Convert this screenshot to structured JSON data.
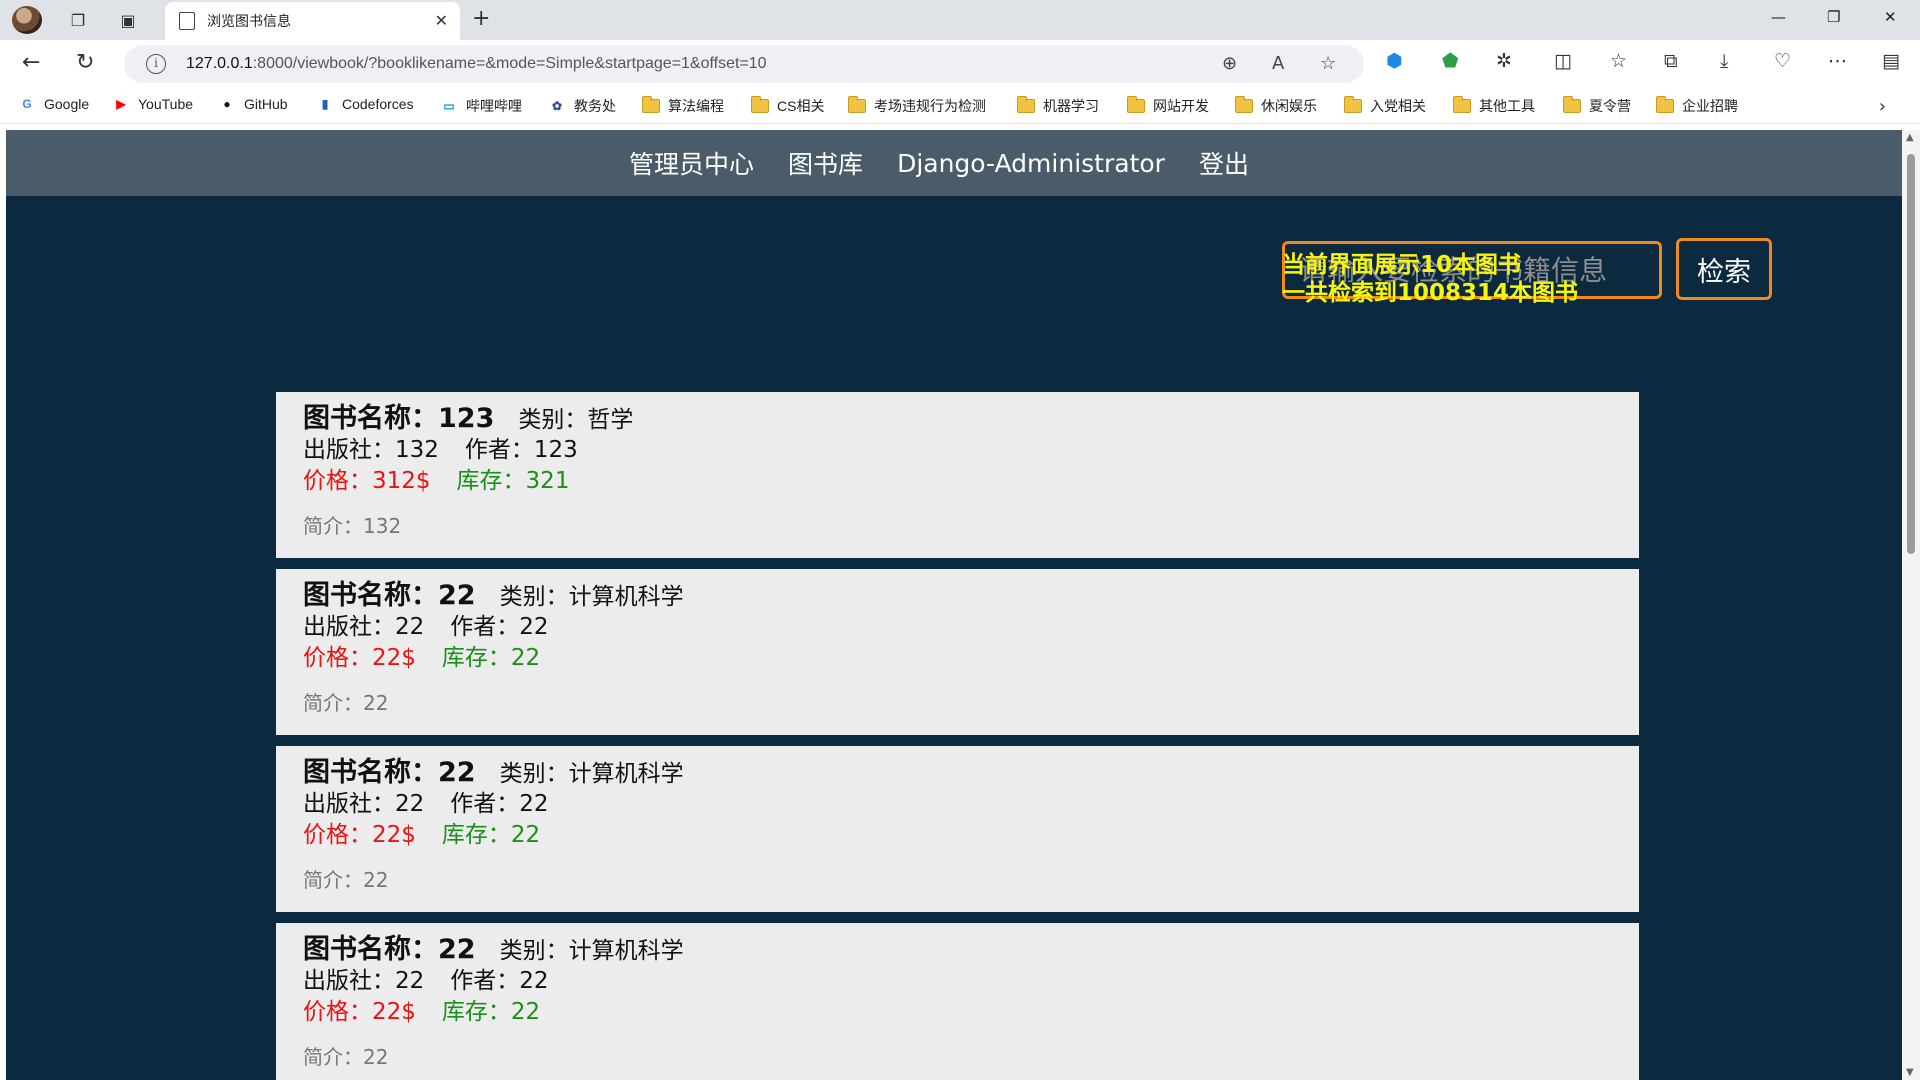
{
  "browser": {
    "tab_title": "浏览图书信息",
    "url_host": "127.0.0.1",
    "url_rest": ":8000/viewbook/?booklikename=&mode=Simple&startpage=1&offset=10",
    "bookmarks": [
      {
        "label": "Google",
        "icon": "google-icon"
      },
      {
        "label": "YouTube",
        "icon": "youtube-icon"
      },
      {
        "label": "GitHub",
        "icon": "github-icon"
      },
      {
        "label": "Codeforces",
        "icon": "codeforces-icon"
      },
      {
        "label": "哔哩哔哩",
        "icon": "bilibili-icon"
      },
      {
        "label": "教务处",
        "icon": "school-icon"
      },
      {
        "label": "算法编程",
        "icon": "folder-icon"
      },
      {
        "label": "CS相关",
        "icon": "folder-icon"
      },
      {
        "label": "考场违规行为检测",
        "icon": "folder-icon"
      },
      {
        "label": "机器学习",
        "icon": "folder-icon"
      },
      {
        "label": "网站开发",
        "icon": "folder-icon"
      },
      {
        "label": "休闲娱乐",
        "icon": "folder-icon"
      },
      {
        "label": "入党相关",
        "icon": "folder-icon"
      },
      {
        "label": "其他工具",
        "icon": "folder-icon"
      },
      {
        "label": "夏令营",
        "icon": "folder-icon"
      },
      {
        "label": "企业招聘",
        "icon": "folder-icon"
      }
    ]
  },
  "nav": {
    "items": [
      "管理员中心",
      "图书库",
      "Django-Administrator",
      "登出"
    ]
  },
  "search": {
    "placeholder": "请输入要检索的书籍信息",
    "button": "检索"
  },
  "stats": {
    "shown": "当前界面展示10本图书",
    "total": "一共检索到1008314本图书"
  },
  "books": [
    {
      "name_label": "图书名称：",
      "name": "123",
      "category": "类别：哲学",
      "publisher": "出版社：132",
      "author": "作者：123",
      "price": "价格：312$",
      "stock": "库存：321",
      "intro": "简介：132"
    },
    {
      "name_label": "图书名称：",
      "name": "22",
      "category": "类别：计算机科学",
      "publisher": "出版社：22",
      "author": "作者：22",
      "price": "价格：22$",
      "stock": "库存：22",
      "intro": "简介：22"
    },
    {
      "name_label": "图书名称：",
      "name": "22",
      "category": "类别：计算机科学",
      "publisher": "出版社：22",
      "author": "作者：22",
      "price": "价格：22$",
      "stock": "库存：22",
      "intro": "简介：22"
    },
    {
      "name_label": "图书名称：",
      "name": "22",
      "category": "类别：计算机科学",
      "publisher": "出版社：22",
      "author": "作者：22",
      "price": "价格：22$",
      "stock": "库存：22",
      "intro": "简介：22"
    }
  ],
  "colors": {
    "page_bg": "#0c2a3f",
    "nav_bg": "#4a5c69",
    "accent_orange": "#f08a1c",
    "stat_yellow": "#f5f510",
    "price_red": "#ee1111",
    "stock_green": "#1a8f1a"
  }
}
